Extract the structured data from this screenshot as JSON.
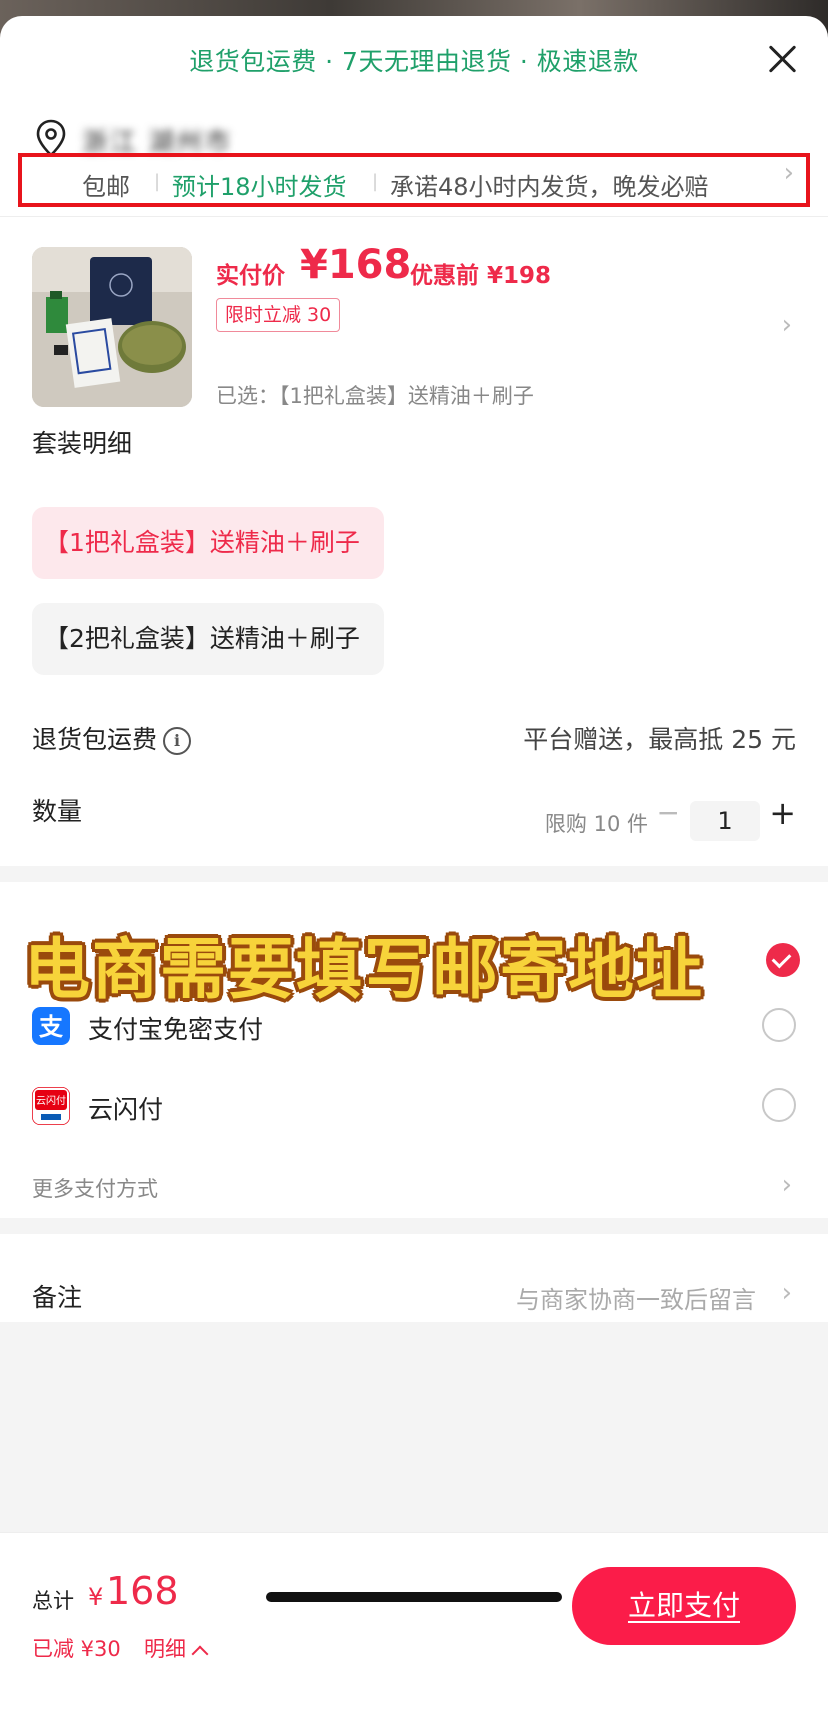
{
  "header": {
    "guarantee_text": "退货包运费 · 7天无理由退货 · 极速退款",
    "address": "浙江 湖州市"
  },
  "shipping": {
    "free_shipping": "包邮",
    "eta": "预计18小时发货",
    "promise": "承诺48小时内发货，晚发必赔"
  },
  "product": {
    "price_label": "实付价",
    "price": "¥168",
    "price_before": "优惠前 ¥198",
    "promo_tag": "限时立减 30",
    "selected": "已选：【1把礼盒装】送精油＋刷子"
  },
  "package": {
    "title": "套装明细",
    "options": [
      {
        "label": "【1把礼盒装】送精油＋刷子",
        "selected": true
      },
      {
        "label": "【2把礼盒装】送精油＋刷子",
        "selected": false
      }
    ]
  },
  "return_shipping": {
    "label": "退货包运费",
    "value": "平台赠送，最高抵 25 元"
  },
  "quantity": {
    "label": "数量",
    "limit": "限购 10 件",
    "value": "1",
    "minus": "−",
    "plus": "+"
  },
  "overlay_caption": "电商需要填写邮寄地址",
  "payment": {
    "methods": [
      {
        "label": "支付宝免密支付",
        "icon": "alipay-icon",
        "color": "#1677ff"
      },
      {
        "label": "云闪付",
        "icon": "unionpay-icon",
        "color": "#e60012"
      }
    ],
    "more": "更多支付方式"
  },
  "remark": {
    "label": "备注",
    "hint": "与商家协商一致后留言"
  },
  "footer": {
    "total_label": "总计",
    "total_yen": "¥",
    "total_amount": "168",
    "reduced": "已减 ¥30",
    "detail": "明细",
    "pay_button": "立即支付"
  },
  "colors": {
    "accent": "#ee2a4a",
    "pay_button": "#fb1c49",
    "guarantee_green": "#1fa06a",
    "highlight_border": "#e8141c"
  }
}
